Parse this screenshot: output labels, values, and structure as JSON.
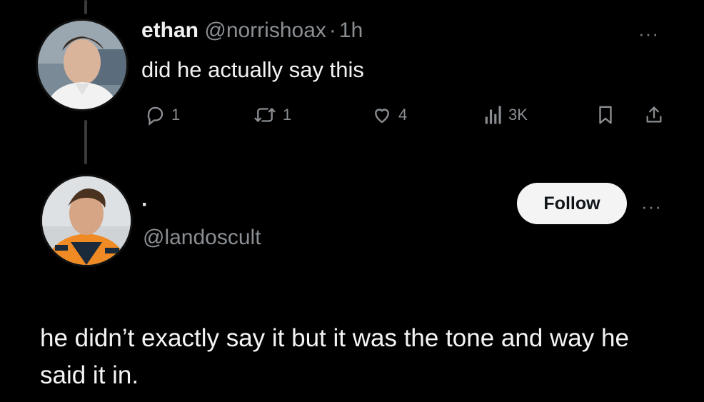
{
  "tweet": {
    "author_name": "ethan",
    "author_handle": "@norrishoax",
    "separator": "·",
    "time": "1h",
    "text": "did he actually say this",
    "more_label": "···",
    "replies": "1",
    "reposts": "1",
    "likes": "4",
    "views": "3K",
    "icons": [
      "reply-icon",
      "repost-icon",
      "like-icon",
      "views-icon",
      "bookmark-icon",
      "share-icon"
    ]
  },
  "reply_user": {
    "display_name": "·",
    "handle": "@landoscult",
    "follow_label": "Follow",
    "more_label": "···"
  },
  "reply": {
    "text": "he didn’t exactly say it but it was the tone and way he said it in."
  },
  "colors": {
    "background": "#000000",
    "text": "#e7e9ea",
    "muted": "#8b8f93",
    "follow_bg": "#f4f4f4"
  }
}
